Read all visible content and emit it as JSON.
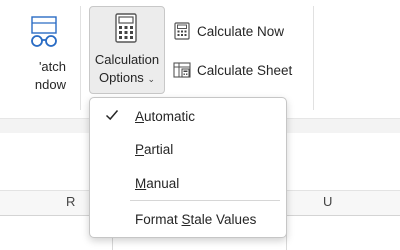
{
  "ribbon": {
    "watch_window": {
      "line1": "'atch",
      "line2": "ndow",
      "icon": "watch-window-glasses-icon"
    },
    "calculation_options": {
      "line1": "Calculation",
      "line2": "Options",
      "chevron": "⌄",
      "icon": "calculator-icon"
    },
    "calculate_now": {
      "label": "Calculate Now",
      "icon": "calculator-small-icon"
    },
    "calculate_sheet": {
      "label": "Calculate Sheet",
      "icon": "calculate-sheet-icon"
    }
  },
  "menu": {
    "items": [
      {
        "pre": "",
        "key": "A",
        "post": "utomatic",
        "checked": true
      },
      {
        "pre": "",
        "key": "P",
        "post": "artial",
        "checked": false
      },
      {
        "pre": "",
        "key": "M",
        "post": "anual",
        "checked": false
      },
      {
        "pre": "Format ",
        "key": "S",
        "post": "tale Values",
        "checked": false
      }
    ]
  },
  "sheet": {
    "columns": [
      "R",
      "U"
    ]
  },
  "colors": {
    "selected_bg": "#ececec",
    "accent_blue": "#1f6fc5",
    "menu_border": "#c6c6c6"
  }
}
